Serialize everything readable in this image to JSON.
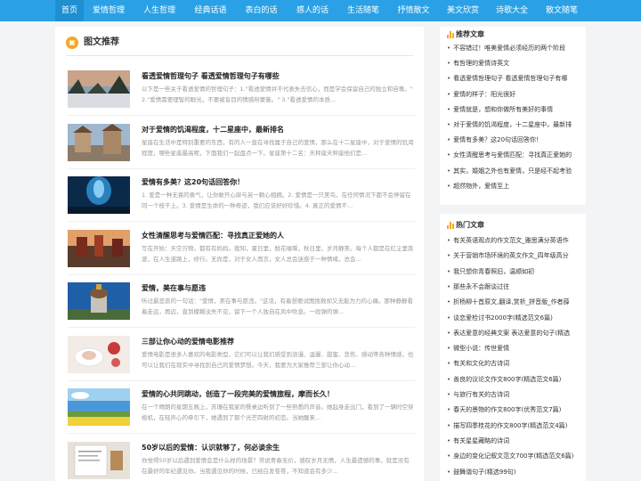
{
  "nav": [
    "首页",
    "爱情哲理",
    "人生哲理",
    "经典话语",
    "表白的话",
    "感人的话",
    "生活随笔",
    "抒情散文",
    "美文欣赏",
    "诗歌大全",
    "散文随笔"
  ],
  "colors": {
    "nav_bg": "#2aa1e6",
    "nav_active": "#1f8fd2",
    "accent": "#f5a623"
  },
  "main": {
    "section_icon": "image-icon",
    "section_title": "图文推荐",
    "articles": [
      {
        "title": "看透爱情哲理句子 看透爱情哲理句子有哪些",
        "desc": "以下是一些关于看透爱情的哲理句子：1.\"看透爱情并不代表失去信心，而是学会保留自己的独立和自尊。\" 2.\"爱情需要理智的眼光，不要被盲目的情感所蒙蔽。\" 3.\"看透爱情的本质..."
      },
      {
        "title": "对于爱情的饥渴程度，十二星座中，最新排名",
        "desc": "星座在生活中是特别重要的东西，有的人一直在寻找属于自己的爱情，那么在十二星座中，对于爱情的饥渴程度，哪些星座最高呢，下面我们一起盘点一下。星座第十二名：天秤座天秤座他们是..."
      },
      {
        "title": "爱情有多美？这20句话回答你！",
        "desc": "1. 爱是一种无畏的勇气，让你敢开心扉与另一颗心相拥。2. 爱情是一只美鸟，在任何情况下都不会停留在同一个枝干上。3. 爱情是生命的一种奇迹，我们应该好好珍惜。4. 真正的爱情不..."
      },
      {
        "title": "女性清醒思考与爱情匹配：寻找真正爱她的人",
        "desc": "写在开始：天空万物，都有有妈妈。我知，夏日里，鲜花璀璨，秋日里，岁月静美。每个人都是在红尘里奔波，在人生道路上，修行。无尚是，对于女人而言，女人总会迷惑于一种情绪，总会..."
      },
      {
        "title": "爱情，美在事与愿违",
        "desc": "听过最悲哀的一句话：\"爱情，美在事与愿违。\"这话，有着想要试图挽救却又无能为力的心痛。那种静静看着走远，再远，直到模糊淡失不见，留下一个人独自在风中吹息。一段弹的弹..."
      },
      {
        "title": "三部让你心动的爱情电影推荐",
        "desc": "爱情电影是很多人喜欢的电影类型，它们可以让我们感受到浪漫、温馨、甜蜜、悲伤、感动等各种情感，也可以让我们在现实中寻找到自己的爱情梦想。今天，我要为大家推荐三部让你心动..."
      },
      {
        "title": "爱情的心共同跳动，创造了一段完美的爱情旅程，摩而长久！",
        "desc": "在一个晴朗的星期五晚上，苏珊在我家的餐桌边听到了一些熟悉的声音。她起身走出门，看到了一辆时空穿梭机，在轻声心的牵引下，她遇到了那个光芒四射的初恋。当她醒来..."
      },
      {
        "title": "50岁以后的爱情：认识就够了，何必谈余生",
        "desc": "你觉得50岁以后遇到爱情会是什么样的场景？常说青春无价，感叹岁月无情，人生最遗憾的事，就是没有在最好的年纪遇见你。当我遇见你的时候，已经白发苍苍，不知道会有多少..."
      }
    ]
  },
  "sidebar": {
    "recommend": {
      "title": "推荐文章",
      "items": [
        "不容错过！唯美爱情必须经历的两个阶段",
        "有哲理的爱情诗英文",
        "看透爱情哲理句子 看透爱情哲理句子有哪",
        "爱情的样子：阳光很好",
        "爱情就是，想和你做所有美好的事情",
        "对于爱情的饥渴程度，十二星座中，最新排",
        "爱情有多美？这20句话回答你！",
        "女性清醒思考与爱情匹配：寻找真正爱她的",
        "其实，婚姻之外也有爱情，只是经不起考验",
        "超然物外，爱情至上"
      ]
    },
    "hot": {
      "title": "热门文章",
      "items": [
        "有关英语观点的作文范文_雅思满分英语作",
        "关于营销市场环境的英文作文_四年级高分",
        "我只想你青春照旧，温顺如初",
        "那些永不会跟谈过往",
        "折杨柳十首原文,翻译,赏析_拼音版_作者薛",
        "谈恋爱检讨书2000字(精选范文6篇)",
        "表达爱意的经典文案 表达爱意的句子(精选",
        "微型小说：传世爱情",
        "有关和文化的古诗词",
        "善良的议论文作文800字(精选范文6篇)",
        "与旅行有关的古诗词",
        "春天的景物的作文800字(优秀范文7篇)",
        "描写四季桂花的作文800字(精选范文4篇)",
        "有关星星藏略的诗词",
        "身边的变化记叙文范文700字(精选范文6篇)",
        "鼓舞谐句子(精选99句)"
      ]
    }
  }
}
